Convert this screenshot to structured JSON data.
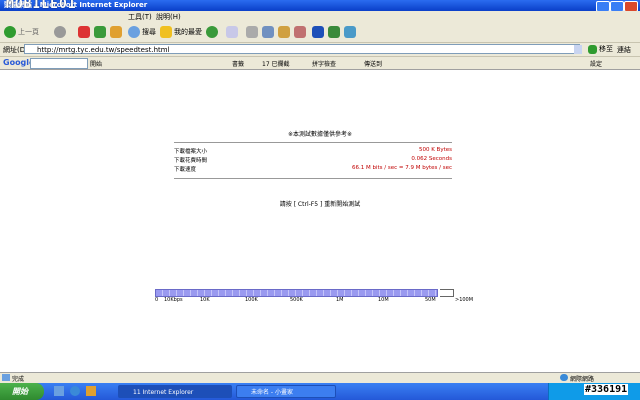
{
  "window": {
    "title": "頭端網站 - Microsoft Internet Explorer",
    "watermark": "MOBILE01"
  },
  "menu": {
    "tools": "工具(T)",
    "help": "說明(H)"
  },
  "toolbar": {
    "back": "上一頁",
    "search": "搜尋",
    "favorites": "我的最愛"
  },
  "address": {
    "label": "網址(D)",
    "url": "http://mrtg.tyc.edu.tw/speedtest.html",
    "go": "移至",
    "links": "連結"
  },
  "google_bar": {
    "logo": "Google",
    "go": "開始",
    "bookmarks": "書籤",
    "blocked": "17 已攔截",
    "spell": "拼字檢查",
    "send": "傳送到",
    "settings": "設定"
  },
  "page": {
    "note": "※本測試數據僅供參考※",
    "rows": [
      {
        "label": "下載檔案大小",
        "value": "500 K Bytes"
      },
      {
        "label": "下載花費時間",
        "value": "0.062 Seconds"
      },
      {
        "label": "下載速度",
        "value": "66.1 M bits / sec = 7.9 M bytes / sec"
      }
    ],
    "restart": "請按 [ Ctrl-F5 ] 重新開始測試",
    "scale": [
      "0",
      "10Kbps",
      "10K",
      "100K",
      "500K",
      "1M",
      "10M",
      "50M",
      ">100M"
    ]
  },
  "status": {
    "left": "完成",
    "right": "網際網路"
  },
  "taskbar": {
    "start": "開始",
    "tasks": [
      "11 Internet Explorer",
      "未命名 - 小畫家"
    ],
    "image_id": "#336191"
  },
  "colors": {
    "accent": "#0a3fc8",
    "speed_bar": "#9a9af0",
    "value_red": "#c00000"
  }
}
